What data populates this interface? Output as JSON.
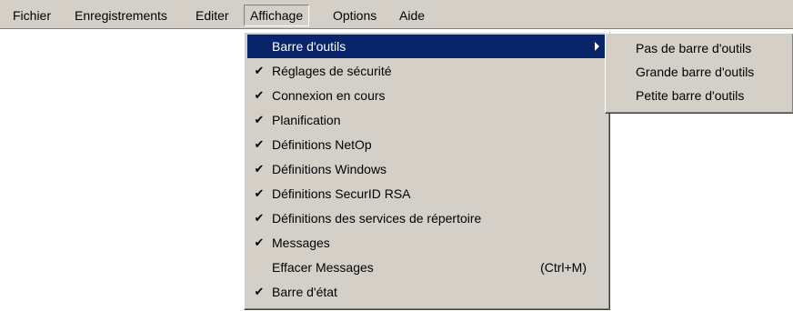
{
  "menubar": {
    "items": [
      "Fichier",
      "Enregistrements",
      "Editer",
      "Affichage",
      "Options",
      "Aide"
    ],
    "active": "Affichage"
  },
  "affichage_menu": {
    "items": [
      {
        "label": "Barre d'outils",
        "checked": false,
        "highlighted": true,
        "has_submenu": true
      },
      {
        "label": "Réglages de sécurité",
        "checked": true
      },
      {
        "label": "Connexion en cours",
        "checked": true
      },
      {
        "label": "Planification",
        "checked": true
      },
      {
        "label": "Définitions NetOp",
        "checked": true
      },
      {
        "label": "Définitions Windows",
        "checked": true
      },
      {
        "label": "Définitions SecurID RSA",
        "checked": true
      },
      {
        "label": "Définitions des services de répertoire",
        "checked": true
      },
      {
        "label": "Messages",
        "checked": true
      },
      {
        "label": "Effacer Messages",
        "checked": false,
        "shortcut": "(Ctrl+M)"
      },
      {
        "label": "Barre d'état",
        "checked": true
      }
    ],
    "check_glyph": "✔"
  },
  "toolbar_submenu": {
    "items": [
      "Pas de barre d'outils",
      "Grande barre d'outils",
      "Petite barre d'outils"
    ]
  },
  "colors": {
    "menu_face": "#d4d0c8",
    "highlight": "#0a246a",
    "highlight_text": "#ffffff"
  }
}
